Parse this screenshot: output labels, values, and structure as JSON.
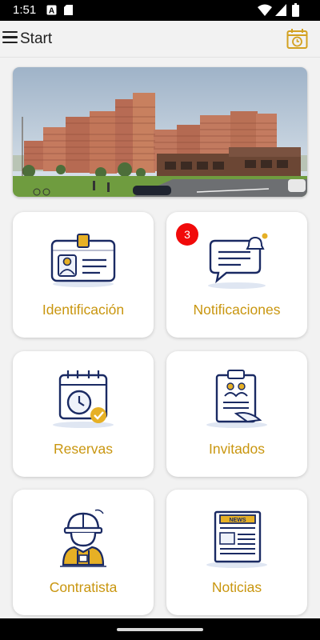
{
  "status_bar": {
    "time": "1:51",
    "icons": [
      "a-notification-icon",
      "sd-card-icon",
      "wifi-icon",
      "cellular-signal-icon",
      "battery-icon"
    ]
  },
  "app_bar": {
    "title": "Start",
    "menu_icon": "hamburger-menu-icon",
    "action_icon": "calendar-clock-icon"
  },
  "banner": {
    "image": "residential-apartment-complex-photo"
  },
  "menu_cards": [
    {
      "label": "Identificación",
      "icon": "id-badge-icon"
    },
    {
      "label": "Notificaciones",
      "icon": "chat-bell-icon",
      "badge": "3"
    },
    {
      "label": "Reservas",
      "icon": "calendar-clock-check-icon"
    },
    {
      "label": "Invitados",
      "icon": "guest-clipboard-icon"
    },
    {
      "label": "Contratista",
      "icon": "construction-worker-icon"
    },
    {
      "label": "Noticias",
      "icon": "newspaper-icon"
    }
  ],
  "colors": {
    "accent": "#c9960f",
    "icon_navy": "#1a2a63",
    "badge_red": "#f10a0a",
    "background": "#f2f2f2"
  }
}
